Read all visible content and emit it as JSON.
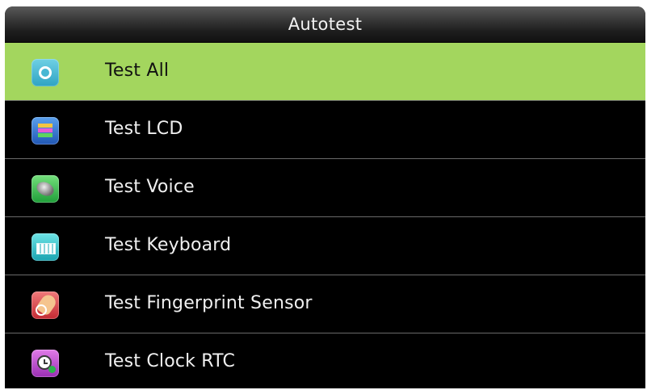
{
  "header": {
    "title": "Autotest"
  },
  "menu": {
    "selected_index": 0,
    "items": [
      {
        "label": "Test All",
        "icon": "test-all-icon",
        "color": "#2ea3c3"
      },
      {
        "label": "Test LCD",
        "icon": "lcd-icon",
        "color": "#2157b5"
      },
      {
        "label": "Test Voice",
        "icon": "speaker-icon",
        "color": "#1f9e39"
      },
      {
        "label": "Test Keyboard",
        "icon": "keyboard-icon",
        "color": "#1aa3b0"
      },
      {
        "label": "Test Fingerprint Sensor",
        "icon": "fingerprint-icon",
        "color": "#c42a33"
      },
      {
        "label": "Test Clock RTC",
        "icon": "clock-icon",
        "color": "#9b2fb4"
      }
    ]
  },
  "colors": {
    "selected_background": "#a3d65e",
    "background": "#000000",
    "text": "#f0f0f0",
    "separator": "#6a6a6a"
  }
}
